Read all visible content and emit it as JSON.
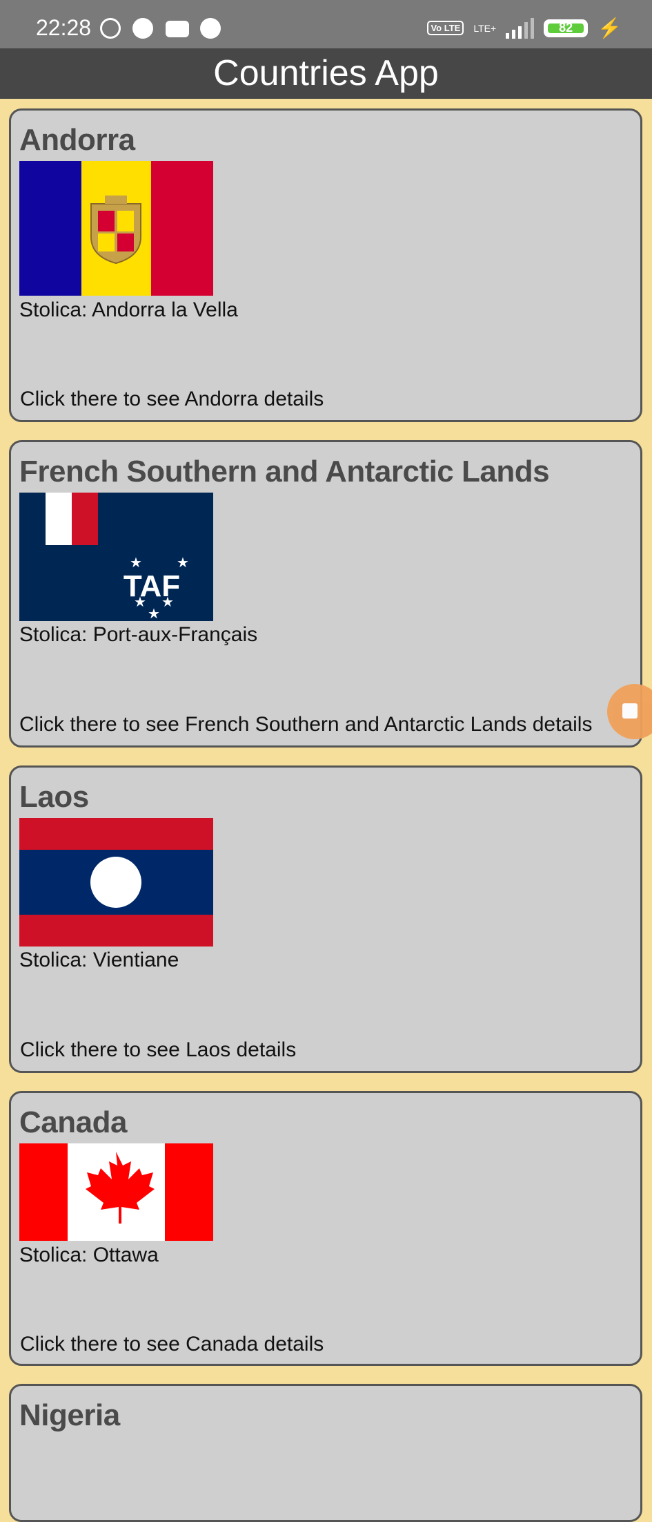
{
  "status_bar": {
    "time": "22:28",
    "network_badge": "Vo LTE",
    "network_type": "LTE+",
    "battery": "82"
  },
  "app": {
    "title": "Countries App"
  },
  "countries": [
    {
      "name": "Andorra",
      "capital": "Stolica: Andorra la Vella",
      "link": "Click there to see Andorra details",
      "flag": {
        "kind": "andorra",
        "colors": [
          "#10069f",
          "#fedf00",
          "#d50032"
        ]
      }
    },
    {
      "name": "French Southern and Antarctic Lands",
      "capital": "Stolica: Port-aux-Français",
      "link": "Click there to see French Southern and Antarctic Lands details",
      "flag": {
        "kind": "taaf",
        "colors": [
          "#002654",
          "#ffffff",
          "#ce1126"
        ]
      }
    },
    {
      "name": "Laos",
      "capital": "Stolica: Vientiane",
      "link": "Click there to see Laos details",
      "flag": {
        "kind": "laos",
        "colors": [
          "#ce1126",
          "#002868",
          "#ffffff"
        ]
      }
    },
    {
      "name": "Canada",
      "capital": "Stolica: Ottawa",
      "link": "Click there to see Canada details",
      "flag": {
        "kind": "canada",
        "colors": [
          "#ff0000",
          "#ffffff"
        ]
      }
    },
    {
      "name": "Nigeria"
    }
  ],
  "colors": {
    "background": "#f5df9a",
    "card": "#cfcfcf",
    "app_bar": "#474747",
    "status_bar": "#7a7a7a"
  }
}
